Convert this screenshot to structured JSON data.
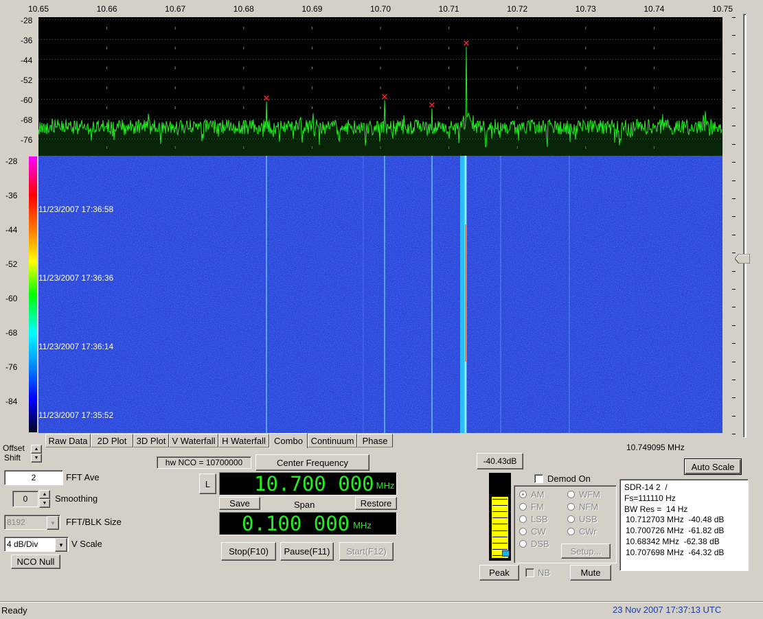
{
  "spectrum": {
    "x_ticks": [
      "10.65",
      "10.66",
      "10.67",
      "10.68",
      "10.69",
      "10.70",
      "10.71",
      "10.72",
      "10.73",
      "10.74",
      "10.75"
    ],
    "y_ticks": [
      "-28",
      "-36",
      "-44",
      "-52",
      "-60",
      "-68",
      "-76"
    ],
    "trace_color": "#22ee22",
    "peak_marker_color": "#ff2020"
  },
  "waterfall": {
    "y_ticks": [
      "-28",
      "-36",
      "-44",
      "-52",
      "-60",
      "-68",
      "-76",
      "-84"
    ],
    "timestamps": [
      "11/23/2007 17:36:58",
      "11/23/2007 17:36:36",
      "11/23/2007 17:36:14",
      "11/23/2007 17:35:52"
    ],
    "background_color": "#2a44d8"
  },
  "tabs": [
    "Raw Data",
    "2D Plot",
    "3D Plot",
    "V Waterfall",
    "H Waterfall",
    "Combo",
    "Continuum",
    "Phase"
  ],
  "active_tab": "Combo",
  "cursor_freq": "10.749095 MHz",
  "left_panel": {
    "offset_label": "Offset",
    "shift_label": "Shift",
    "fft_ave_value": "2",
    "fft_ave_label": "FFT Ave",
    "smoothing_value": "0",
    "smoothing_label": "Smoothing",
    "fft_blk_value": "8192",
    "fft_blk_label": "FFT/BLK Size",
    "vscale_value": "4 dB/Div",
    "vscale_label": "V Scale",
    "nco_null": "NCO Null"
  },
  "center": {
    "hw_nco": "hw NCO = 10700000",
    "center_freq_button": "Center Frequency",
    "l_button": "L",
    "freq_value": "10.700 000",
    "freq_unit": "MHz",
    "save": "Save",
    "span_label": "Span",
    "restore": "Restore",
    "span_value": "0.100 000",
    "span_unit": "MHz",
    "stop": "Stop(F10)",
    "pause": "Pause(F11)",
    "start": "Start(F12)"
  },
  "demod": {
    "level": "-40.43dB",
    "demod_on": "Demod On",
    "modes_left": [
      "AM",
      "FM",
      "LSB",
      "CW",
      "DSB"
    ],
    "modes_right": [
      "WFM",
      "NFM",
      "USB",
      "CWr"
    ],
    "setup": "Setup...",
    "peak": "Peak",
    "nb": "NB",
    "mute": "Mute",
    "meter_fill_color": "#ffff00",
    "meter_level": 0.72
  },
  "info": {
    "auto_scale": "Auto Scale",
    "lines": [
      "SDR-14 2  /",
      "Fs=111110 Hz",
      "BW Res =  14 Hz"
    ],
    "peaks": [
      "10.712703 MHz  -40.48 dB",
      "10.700726 MHz  -61.82 dB",
      "10.68342 MHz  -62.38 dB",
      "10.707698 MHz  -64.32 dB"
    ]
  },
  "status": {
    "text": "Ready",
    "datetime": "23 Nov 2007  17:37:13 UTC",
    "datetime_color": "#1a3da8"
  }
}
